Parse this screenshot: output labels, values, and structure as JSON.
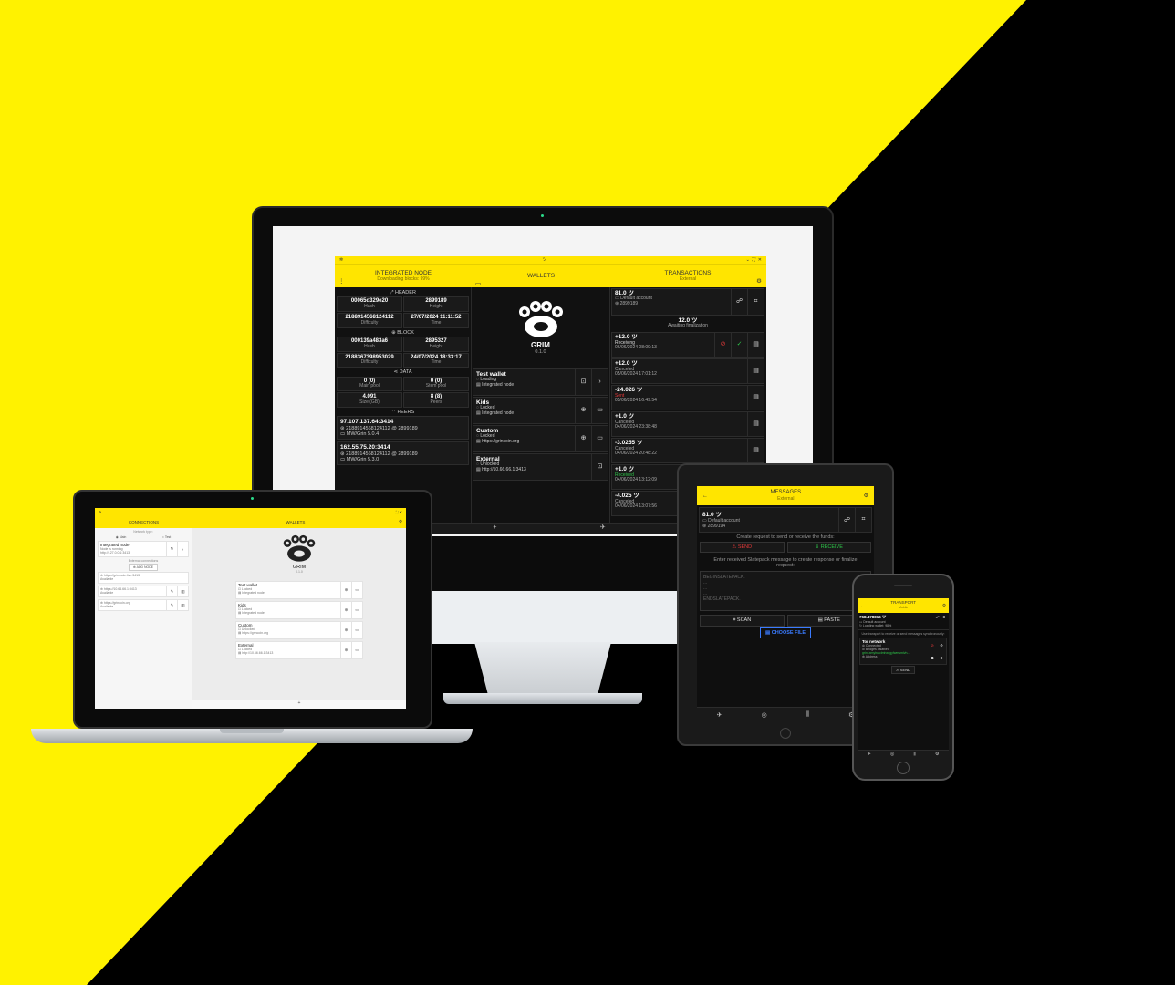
{
  "desktop": {
    "titlebar_glyph": "ツ",
    "header": {
      "node": {
        "title": "INTEGRATED NODE",
        "sub": "Downloading blocks: 99%"
      },
      "wallets": {
        "title": "WALLETS"
      },
      "tx": {
        "title": "TRANSACTIONS",
        "sub": "External"
      }
    },
    "node": {
      "header_title": "HEADER",
      "header_cells": [
        {
          "v": "00065d329e20",
          "l": "Hash"
        },
        {
          "v": "2899189",
          "l": "Height"
        },
        {
          "v": "2188914568124112",
          "l": "Difficulty"
        },
        {
          "v": "27/07/2024 11:11:52",
          "l": "Time"
        }
      ],
      "block_title": "BLOCK",
      "block_cells": [
        {
          "v": "000139a483a6",
          "l": "Hash"
        },
        {
          "v": "2895327",
          "l": "Height"
        },
        {
          "v": "2188367398953029",
          "l": "Difficulty"
        },
        {
          "v": "24/07/2024 18:33:17",
          "l": "Time"
        }
      ],
      "data_title": "DATA",
      "data_cells": [
        {
          "v": "0 (0)",
          "l": "Main pool"
        },
        {
          "v": "0 (0)",
          "l": "Stem pool"
        },
        {
          "v": "4.091",
          "l": "Size (GB)"
        },
        {
          "v": "8 (8)",
          "l": "Peers"
        }
      ],
      "peers_title": "PEERS",
      "peers": [
        {
          "addr": "97.107.137.64:3414",
          "diff": "2188914568124112 @ 2899189",
          "ver": "MW/Grin 5.0.4"
        },
        {
          "addr": "162.55.75.20:3414",
          "diff": "2188914568124112 @ 2899189",
          "ver": "MW/Grin 5.3.0"
        }
      ]
    },
    "logo": {
      "name": "GRIM",
      "version": "0.1.0"
    },
    "wallets": [
      {
        "name": "Test wallet",
        "status": "Loading",
        "conn": "Integrated node"
      },
      {
        "name": "Kids",
        "status": "Locked",
        "conn": "Integrated node"
      },
      {
        "name": "Custom",
        "status": "Locked",
        "conn": "https://grincoin.org"
      },
      {
        "name": "External",
        "status": "Unlocked",
        "conn": "http://10.66.66.1:3413"
      }
    ],
    "account": {
      "amount": "81.0 ツ",
      "name": "Default account",
      "height": "2899189"
    },
    "awaiting": {
      "amount": "12.0 ツ",
      "label": "Awaiting finalization"
    },
    "transactions": [
      {
        "amount": "+12.0 ツ",
        "status": "Receiving",
        "date": "06/06/2024 08:09:13"
      },
      {
        "amount": "+12.0 ツ",
        "status": "Canceled",
        "date": "05/06/2024 17:01:12"
      },
      {
        "amount": "-24.026 ツ",
        "status": "Sent",
        "date": "05/06/2024 16:49:54"
      },
      {
        "amount": "+1.0 ツ",
        "status": "Canceled",
        "date": "04/06/2024 23:38:48"
      },
      {
        "amount": "-3.0255 ツ",
        "status": "Canceled",
        "date": "04/06/2024 20:48:22"
      },
      {
        "amount": "+1.0 ツ",
        "status": "Received",
        "date": "04/06/2024 13:12:09"
      },
      {
        "amount": "-4.025 ツ",
        "status": "Canceled",
        "date": "04/06/2024 13:07:56"
      }
    ]
  },
  "laptop": {
    "header": {
      "left": "CONNECTIONS",
      "right": "WALLETS"
    },
    "network_label": "Network type:",
    "radio_main": "Main",
    "radio_test": "Test",
    "node": {
      "name": "Integrated node",
      "status": "Node is running",
      "url": "http://127.0.0.1:3413"
    },
    "external_label": "External connections",
    "add_node": "ADD NODE",
    "externals": [
      {
        "url": "https://grinnode.live:3413",
        "status": "Available"
      },
      {
        "url": "https://10.66.66.1:3413",
        "status": "Available"
      },
      {
        "url": "https://grincoin.org",
        "status": "Available"
      }
    ],
    "logo": {
      "name": "GRIM",
      "version": "0.1.0"
    },
    "wallets": [
      {
        "name": "Test wallet",
        "status": "Locked",
        "conn": "Integrated node"
      },
      {
        "name": "Kids",
        "status": "Locked",
        "conn": "Integrated node"
      },
      {
        "name": "Custom",
        "status": "Unlocked",
        "conn": "https://grincoin.org"
      },
      {
        "name": "External",
        "status": "Locked",
        "conn": "http://10.66.66.1:3413"
      }
    ]
  },
  "tablet": {
    "header": {
      "title": "MESSAGES",
      "sub": "External"
    },
    "account": {
      "amount": "81.0 ツ",
      "name": "Default account",
      "height": "2899194"
    },
    "create_label": "Create request to send or receive the funds:",
    "send": "SEND",
    "receive": "RECEIVE",
    "enter_label": "Enter received Slatepack message to create response or finalize request:",
    "slate": [
      "BEGINSLATEPACK.",
      "...",
      "...",
      "...",
      "ENDSLATEPACK."
    ],
    "scan": "SCAN",
    "paste": "PASTE",
    "choose": "CHOOSE FILE"
  },
  "phone": {
    "header": {
      "title": "TRANSPORT",
      "sub": "Mobile"
    },
    "account": {
      "amount": "768.478816 ツ",
      "name": "Default account",
      "status": "Loading wallet: 98%"
    },
    "hint": "Use transport to receive or send messages synchronously:",
    "tor": {
      "title": "Tor network",
      "status": "Connected",
      "bridges": "Bridges disabled",
      "address": "grin1xmyhutclmhxugyfwmsmlvh...",
      "address_label": "Address"
    },
    "send": "SEND"
  },
  "colors": {
    "accent": "#ffe500",
    "sent": "#e83a3a",
    "received": "#2ec84a"
  }
}
